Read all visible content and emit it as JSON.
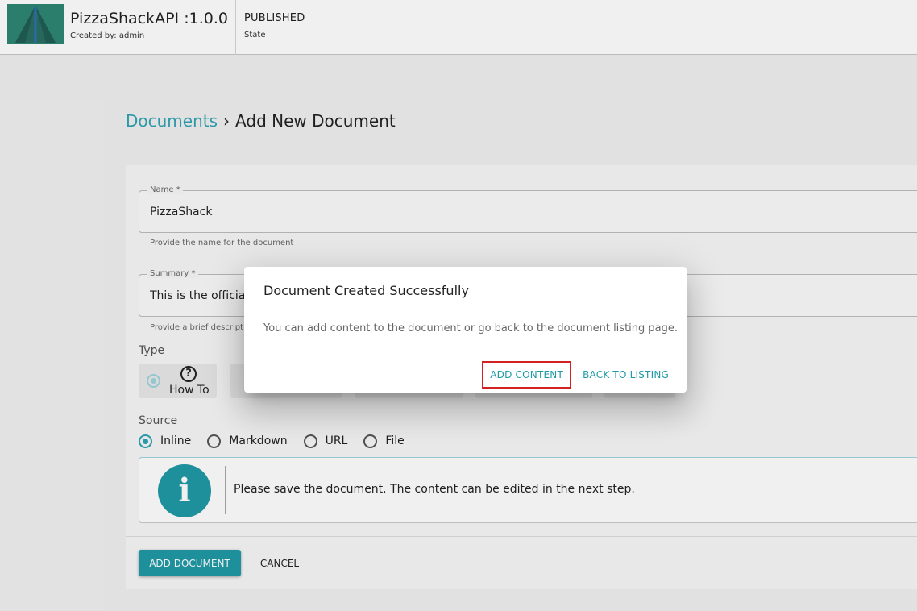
{
  "header": {
    "api_name": "PizzaShackAPI :1.0.0",
    "created_by": "Created by: admin",
    "state": "PUBLISHED",
    "state_label": "State"
  },
  "breadcrumb": {
    "link": "Documents",
    "separator": "›",
    "current": "Add New Document"
  },
  "form": {
    "name_label": "Name *",
    "name_value": "PizzaShack",
    "name_helper": "Provide the name for the document",
    "summary_label": "Summary *",
    "summary_value": "This is the official d",
    "summary_helper": "Provide a brief descripti",
    "type_label": "Type",
    "type_how_to": "How To",
    "type_icon_glyph": "?",
    "source_label": "Source",
    "source_options": [
      "Inline",
      "Markdown",
      "URL",
      "File"
    ],
    "info_text": "Please save the document. The content can be edited in the next step.",
    "info_icon_glyph": "i",
    "add_document": "ADD DOCUMENT",
    "cancel": "CANCEL"
  },
  "dialog": {
    "title": "Document Created Successfully",
    "message": "You can add content to the document or go back to the document listing page.",
    "add_content": "ADD CONTENT",
    "back_to_listing": "BACK TO LISTING"
  },
  "colors": {
    "accent": "#1f9aa6",
    "highlight": "#d32020"
  }
}
